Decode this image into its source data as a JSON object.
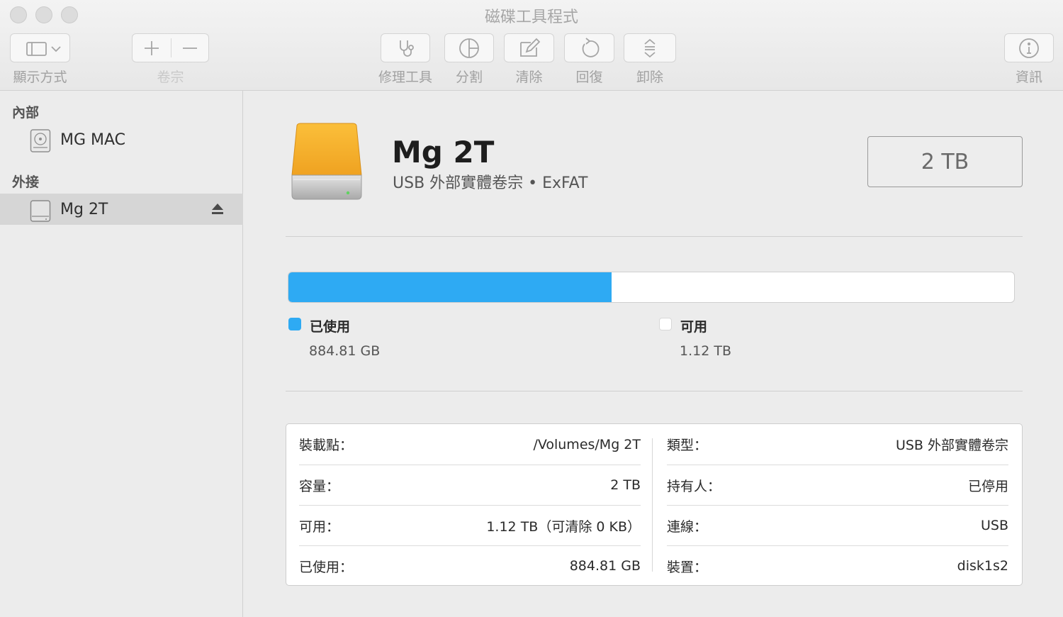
{
  "window": {
    "title": "磁碟工具程式"
  },
  "toolbar": {
    "view_label": "顯示方式",
    "volume_label": "卷宗",
    "first_aid_label": "修理工具",
    "partition_label": "分割",
    "erase_label": "清除",
    "restore_label": "回復",
    "unmount_label": "卸除",
    "info_label": "資訊"
  },
  "sidebar": {
    "internal_header": "內部",
    "external_header": "外接",
    "internal_items": [
      {
        "label": "MG MAC",
        "icon": "internal-disk-icon"
      }
    ],
    "external_items": [
      {
        "label": "Mg 2T",
        "icon": "external-disk-icon",
        "selected": true
      }
    ]
  },
  "volume": {
    "name": "Mg 2T",
    "subtitle": "USB 外部實體卷宗 • ExFAT",
    "capacity": "2 TB"
  },
  "usage": {
    "used_fraction": 0.445,
    "used_color": "#2eaaf3",
    "free_color": "#ffffff",
    "used_label": "已使用",
    "used_value": "884.81 GB",
    "free_label": "可用",
    "free_value": "1.12 TB"
  },
  "info": {
    "left": [
      {
        "key": "裝載點：",
        "value": "/Volumes/Mg 2T"
      },
      {
        "key": "容量：",
        "value": "2 TB"
      },
      {
        "key": "可用：",
        "value": "1.12 TB（可清除 0 KB）"
      },
      {
        "key": "已使用：",
        "value": "884.81 GB"
      }
    ],
    "right": [
      {
        "key": "類型：",
        "value": "USB 外部實體卷宗"
      },
      {
        "key": "持有人：",
        "value": "已停用"
      },
      {
        "key": "連線：",
        "value": "USB"
      },
      {
        "key": "裝置：",
        "value": "disk1s2"
      }
    ]
  }
}
